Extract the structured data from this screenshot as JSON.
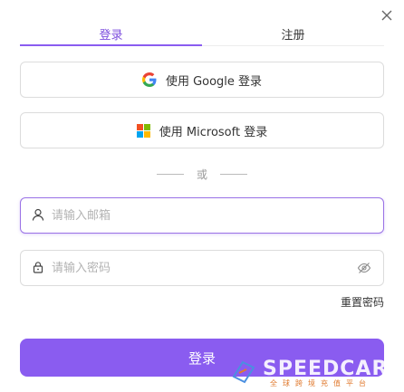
{
  "tabs": {
    "login": "登录",
    "register": "注册"
  },
  "oauth": {
    "google_label": "使用 Google 登录",
    "microsoft_label": "使用 Microsoft 登录"
  },
  "divider_text": "或",
  "form": {
    "email_placeholder": "请输入邮箱",
    "password_placeholder": "请输入密码",
    "forgot_label": "重置密码",
    "submit_label": "登录"
  },
  "watermark": {
    "brand": "SPEEDCARD",
    "tagline": "全球跨境充值平台"
  },
  "colors": {
    "accent": "#8a5cf0",
    "google_blue": "#4285F4",
    "ms_red": "#F25022",
    "ms_green": "#7FBA00",
    "ms_blue": "#00A4EF",
    "ms_yellow": "#FFB900"
  }
}
